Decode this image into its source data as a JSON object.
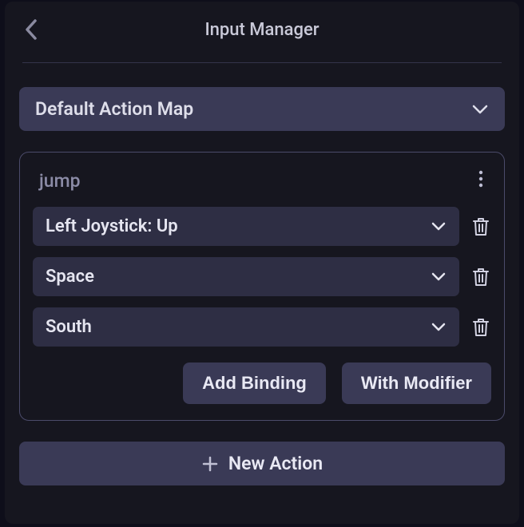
{
  "header": {
    "title": "Input Manager"
  },
  "actionMap": {
    "selected": "Default Action Map"
  },
  "action": {
    "name": "jump",
    "bindings": [
      {
        "label": "Left Joystick: Up"
      },
      {
        "label": "Space"
      },
      {
        "label": "South"
      }
    ],
    "addBindingLabel": "Add Binding",
    "withModifierLabel": "With Modifier"
  },
  "newActionLabel": "New Action"
}
